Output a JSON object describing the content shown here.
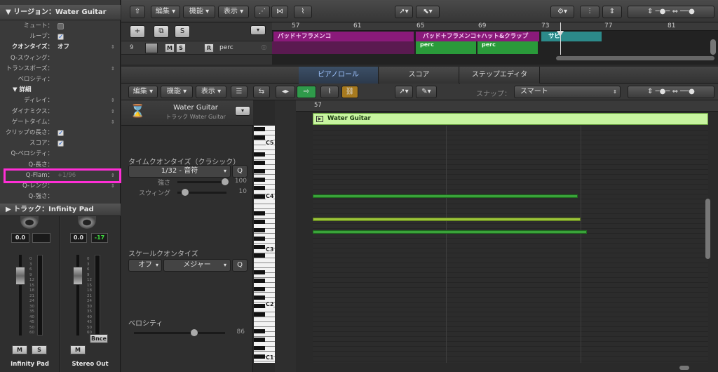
{
  "inspector": {
    "region_header": "▼ リージョン：Water Guitar",
    "params": [
      {
        "label": "ミュート：",
        "type": "checkbox",
        "checked": false
      },
      {
        "label": "ループ：",
        "type": "checkbox",
        "checked": true
      },
      {
        "label": "クオンタイズ：",
        "value": "オフ",
        "type": "value",
        "bold": true
      },
      {
        "label": "Q-スウィング：",
        "type": "empty"
      },
      {
        "label": "トランスポーズ：",
        "type": "stepper"
      },
      {
        "label": "ベロシティ：",
        "type": "empty"
      },
      {
        "label": "▼ 詳細",
        "type": "section"
      },
      {
        "label": "ディレイ：",
        "type": "stepper"
      },
      {
        "label": "ダイナミクス：",
        "type": "stepper"
      },
      {
        "label": "ゲートタイム：",
        "type": "stepper"
      },
      {
        "label": "クリップの長さ：",
        "type": "checkbox",
        "checked": true
      },
      {
        "label": "スコア：",
        "type": "checkbox",
        "checked": true
      },
      {
        "label": "Q-ベロシティ：",
        "type": "empty"
      },
      {
        "label": "Q-長さ：",
        "type": "empty"
      },
      {
        "label": "Q-Flam：",
        "value": "+1/96",
        "type": "value",
        "dim": true
      },
      {
        "label": "Q-レンジ：",
        "type": "stepper"
      },
      {
        "label": "Q-強さ：",
        "type": "empty"
      }
    ],
    "track_header": "▶ トラック：Infinity Pad",
    "strips": [
      {
        "name": "Infinity Pad",
        "value1": "0.0",
        "value2": "",
        "scale": [
          "0",
          "3",
          "6",
          "9",
          "12",
          "15",
          "18",
          "21",
          "24",
          "30",
          "35",
          "40",
          "45",
          "50",
          "60"
        ]
      },
      {
        "name": "Stereo Out",
        "value1": "0.0",
        "value2": "-17",
        "scale": [
          "0",
          "3",
          "6",
          "9",
          "12",
          "15",
          "18",
          "21",
          "24",
          "30",
          "35",
          "40",
          "45",
          "50",
          "60"
        ],
        "bnce": "Bnce"
      }
    ],
    "m_label": "M",
    "s_label": "S"
  },
  "top_toolbar": {
    "menus": [
      "編集",
      "機能",
      "表示"
    ]
  },
  "tracks_area": {
    "ruler": [
      "57",
      "61",
      "65",
      "69",
      "73",
      "77",
      "81"
    ],
    "add_label": "+",
    "s_label": "S",
    "track": {
      "number": "9",
      "m": "M",
      "s": "S",
      "r": "R",
      "name": "perc"
    },
    "regions_top": [
      "パッド＋フラメンコ",
      "パッド＋フラメンコ+ハット&クラップ",
      "サビ"
    ],
    "regions_bottom": [
      "perc",
      "perc"
    ]
  },
  "tabs": [
    "ピアノロール",
    "スコア",
    "ステップエディタ"
  ],
  "editor_toolbar": {
    "menus": [
      "編集",
      "機能",
      "表示"
    ],
    "snap_label": "スナップ：",
    "snap_value": "スマート"
  },
  "editor_inspector": {
    "region_name": "Water Guitar",
    "track_line": "トラック Water Guitar",
    "time_quantize_title": "タイムクオンタイズ（クラシック）",
    "time_quantize_value": "1/32 - 音符",
    "q_label": "Q",
    "strength_label": "強さ",
    "strength_value": "100",
    "swing_label": "スウィング",
    "swing_value": "10",
    "scale_quantize_title": "スケールクオンタイズ",
    "scale_off": "オフ",
    "scale_mode": "メジャー",
    "velocity_title": "ベロシティ",
    "velocity_value": "86"
  },
  "piano_roll": {
    "bar_label": "57",
    "region_label": "Water Guitar",
    "octaves": [
      "C5",
      "C4",
      "C3",
      "C2",
      "C1"
    ]
  },
  "colors": {
    "highlight": "#ff2ed6",
    "region_green": "#c8f5a0",
    "note_green": "#3aa33a",
    "note_yellow": "#9cc43a",
    "tab_active": "#9fc4ff"
  }
}
